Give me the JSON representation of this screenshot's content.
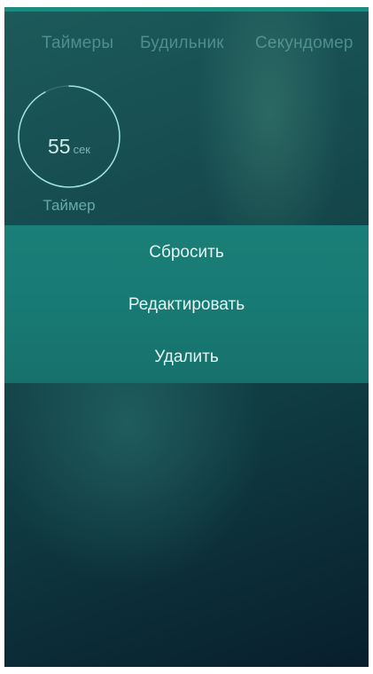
{
  "header": {
    "tabs": [
      {
        "label": "Таймеры"
      },
      {
        "label": "Будильник"
      },
      {
        "label": "Секундомер"
      }
    ]
  },
  "timer": {
    "value": "55",
    "unit": "сек",
    "label": "Таймер",
    "progress": 0.92
  },
  "context_menu": {
    "items": [
      {
        "label": "Сбросить"
      },
      {
        "label": "Редактировать"
      },
      {
        "label": "Удалить"
      }
    ]
  },
  "colors": {
    "accent": "#1a7f78",
    "ring": "#9fe3dc",
    "background_dark": "#0b2a36"
  }
}
